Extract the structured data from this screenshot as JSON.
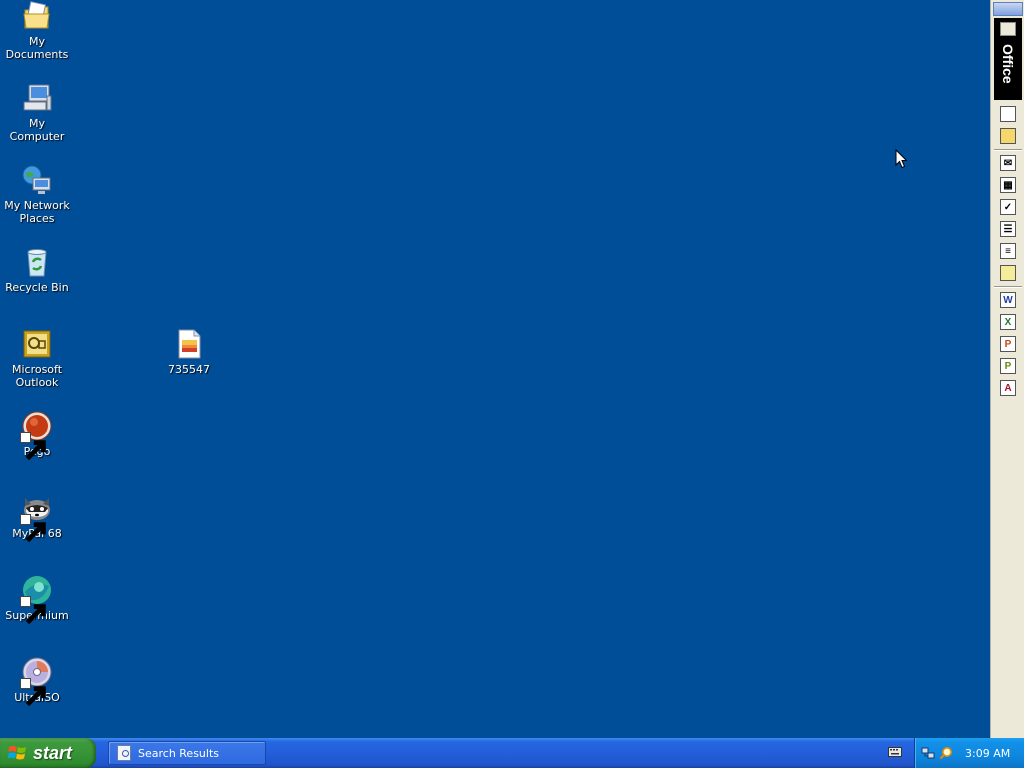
{
  "desktop": {
    "background_color": "#004e98",
    "icons": [
      {
        "label": "My Documents",
        "icon": "my-documents-icon"
      },
      {
        "label": "My Computer",
        "icon": "my-computer-icon"
      },
      {
        "label": "My Network Places",
        "icon": "network-places-icon"
      },
      {
        "label": "Recycle Bin",
        "icon": "recycle-bin-icon"
      },
      {
        "label": "Microsoft Outlook",
        "icon": "outlook-icon"
      },
      {
        "label": "735547",
        "icon": "image-file-icon"
      },
      {
        "label": "Pego",
        "icon": "pego-icon",
        "shortcut": true
      },
      {
        "label": "MyPal 68",
        "icon": "mypal-icon",
        "shortcut": true
      },
      {
        "label": "Supermium",
        "icon": "supermium-icon",
        "shortcut": true
      },
      {
        "label": "UltraISO",
        "icon": "ultraiso-icon",
        "shortcut": true
      }
    ]
  },
  "office_bar": {
    "title": "Office",
    "buttons": [
      {
        "icon": "new-office-document-icon"
      },
      {
        "icon": "open-office-document-icon"
      },
      {
        "icon": "new-message-icon"
      },
      {
        "icon": "new-appointment-icon"
      },
      {
        "icon": "new-task-icon"
      },
      {
        "icon": "new-contact-icon"
      },
      {
        "icon": "new-journal-entry-icon"
      },
      {
        "icon": "new-note-icon"
      },
      {
        "icon": "word-icon",
        "letter": "W",
        "color": "#1f3fa8"
      },
      {
        "icon": "excel-icon",
        "letter": "X",
        "color": "#1e7a2e"
      },
      {
        "icon": "powerpoint-icon",
        "letter": "P",
        "color": "#c2491a"
      },
      {
        "icon": "publisher-icon",
        "letter": "P",
        "color": "#6a8a14"
      },
      {
        "icon": "access-icon",
        "letter": "A",
        "color": "#a3162b"
      }
    ]
  },
  "taskbar": {
    "start_label": "start",
    "tasks": [
      {
        "label": "Search Results",
        "icon": "search-results-icon"
      }
    ],
    "tray_icons": [
      "network-icon",
      "search-tray-icon"
    ],
    "clock": "3:09 AM"
  }
}
